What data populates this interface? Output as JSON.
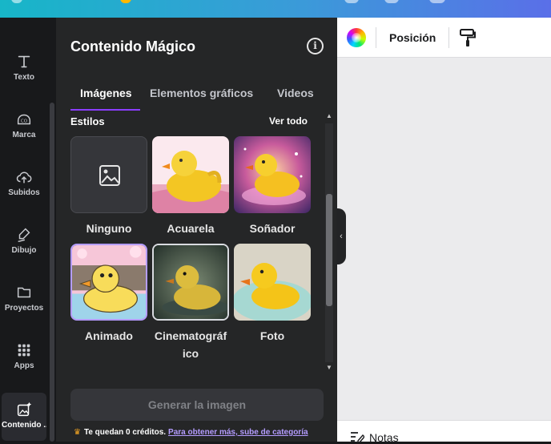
{
  "rail": {
    "items": [
      {
        "label": "Texto",
        "icon": "text-icon"
      },
      {
        "label": "Marca",
        "icon": "brand-icon"
      },
      {
        "label": "Subidos",
        "icon": "upload-cloud-icon"
      },
      {
        "label": "Dibujo",
        "icon": "draw-pen-icon"
      },
      {
        "label": "Proyectos",
        "icon": "folder-icon"
      },
      {
        "label": "Apps",
        "icon": "apps-grid-icon"
      },
      {
        "label": "Contenido ...",
        "icon": "magic-image-icon"
      }
    ]
  },
  "panel": {
    "title": "Contenido Mágico",
    "tabs": [
      "Imágenes",
      "Elementos gráficos",
      "Videos"
    ],
    "active_tab": "Imágenes",
    "section_title": "Estilos",
    "see_all": "Ver todo",
    "styles": [
      {
        "label": "Ninguno",
        "selected": false
      },
      {
        "label": "Acuarela",
        "selected": false
      },
      {
        "label": "Soñador",
        "selected": false
      },
      {
        "label": "Animado",
        "selected": true
      },
      {
        "label": "Cinematográf ico",
        "selected": false
      },
      {
        "label": "Foto",
        "selected": false
      }
    ],
    "generate_button": "Generar la imagen",
    "credits_text": "Te quedan 0 créditos.",
    "credits_link": "Para obtener más, sube de categoría"
  },
  "canvas": {
    "toolbar": {
      "position_label": "Posición"
    },
    "footer": {
      "notes_label": "Notas"
    }
  },
  "colors": {
    "accent": "#8b3dff",
    "panel_bg": "#252627",
    "rail_bg": "#18191b",
    "selected_border": "#b49cff"
  }
}
